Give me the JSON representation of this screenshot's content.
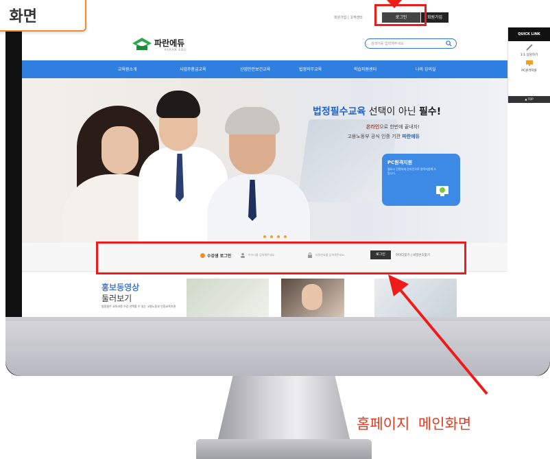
{
  "callout": {
    "text": "화면"
  },
  "util": {
    "links": "회원가입 | 고객센터",
    "login": "로그인",
    "join": "회원가입"
  },
  "logo": {
    "name": "파란에듀",
    "sub": "PARAN EDU"
  },
  "search": {
    "placeholder": "검색어를 입력해주세요"
  },
  "quick": {
    "title": "QUICK LINK",
    "items": [
      {
        "label": "1:1 상담하기",
        "icon": "pencil-icon"
      },
      {
        "label": "PC원격지원",
        "icon": "monitor-icon"
      }
    ],
    "top": "▲ TOP"
  },
  "nav": [
    "교육원소개",
    "사업주환급교육",
    "산업안전보건교육",
    "법정의무교육",
    "학습지원센터",
    "나의 강의실"
  ],
  "hero": {
    "headline_blue": "법정필수교육",
    "headline_mid": " 선택이 아닌 ",
    "headline_bold": "필수!",
    "sub1_bold": "온라인",
    "sub1_rest": "으로 한번에 끝내자!",
    "sub2_rest": "고용노동부 공식 인증 기관 ",
    "sub2_bold": "파란에듀",
    "pc_card": {
      "title": "PC원격지원",
      "desc": "필요시 간편하게 온라인으로 원격지원해 드립니다."
    }
  },
  "login_bar": {
    "title": "수강생 로그인",
    "id_placeholder": "아이디를 입력해주세요.",
    "pw_placeholder": "비밀번호를 입력해주세요.",
    "button": "로그인",
    "links": "아이디찾기 | 비밀번호찾기"
  },
  "promo": {
    "line1": "홍보동영상",
    "line2": "둘러보기",
    "desc": "법정필수 교육과정 수강 선택할 수 있는 고용노동부 인증교육기관"
  },
  "caption": "홈페이지 메인화면 ",
  "colors": {
    "accent": "#2f7fe0",
    "highlight": "#ee1b1b",
    "caption": "#e03b1f",
    "callout_border": "#f08a2a"
  }
}
